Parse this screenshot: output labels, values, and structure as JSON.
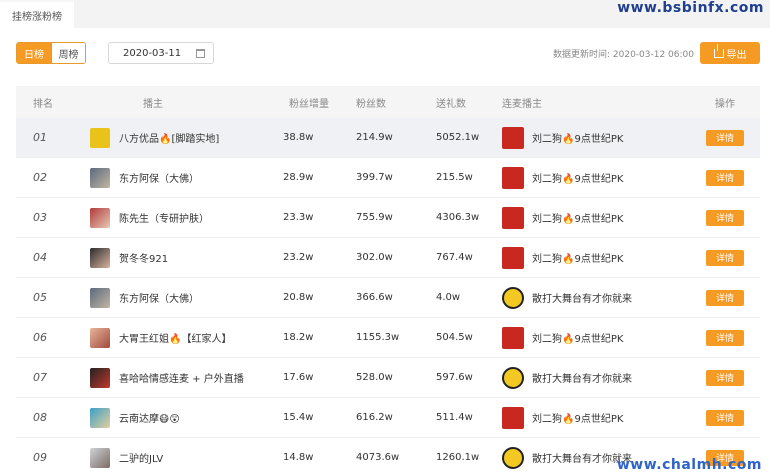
{
  "header": {
    "tab_label": "挂榜涨粉榜",
    "watermark_top": "www.bsbinfx.com",
    "watermark_bottom": "www.chalmh.com"
  },
  "filters": {
    "daily_label": "日榜",
    "weekly_label": "周榜",
    "date_value": "2020-03-11",
    "update_label": "数据更新时间: 2020-03-12 06:00",
    "export_label": "导出"
  },
  "table": {
    "columns": [
      "排名",
      "播主",
      "粉丝增量",
      "粉丝数",
      "送礼数",
      "连麦播主",
      "操作"
    ],
    "detail_label": "详情",
    "rows": [
      {
        "rank": "01",
        "anchor": "八方优品🔥[脚踏实地]",
        "fans_inc": "38.8w",
        "fans": "214.9w",
        "gifts": "5052.1w",
        "link_anchor": "刘二狗🔥9点世纪PK",
        "link_type": "red"
      },
      {
        "rank": "02",
        "anchor": "东方阿保（大佛）",
        "fans_inc": "28.9w",
        "fans": "399.7w",
        "gifts": "215.5w",
        "link_anchor": "刘二狗🔥9点世纪PK",
        "link_type": "red"
      },
      {
        "rank": "03",
        "anchor": "陈先生（专研护肤）",
        "fans_inc": "23.3w",
        "fans": "755.9w",
        "gifts": "4306.3w",
        "link_anchor": "刘二狗🔥9点世纪PK",
        "link_type": "red"
      },
      {
        "rank": "04",
        "anchor": "贺冬冬921",
        "fans_inc": "23.2w",
        "fans": "302.0w",
        "gifts": "767.4w",
        "link_anchor": "刘二狗🔥9点世纪PK",
        "link_type": "red"
      },
      {
        "rank": "05",
        "anchor": "东方阿保（大佛）",
        "fans_inc": "20.8w",
        "fans": "366.6w",
        "gifts": "4.0w",
        "link_anchor": "散打大舞台有才你就来",
        "link_type": "yellow"
      },
      {
        "rank": "06",
        "anchor": "大胃王红姐🔥【红家人】",
        "fans_inc": "18.2w",
        "fans": "1155.3w",
        "gifts": "504.5w",
        "link_anchor": "刘二狗🔥9点世纪PK",
        "link_type": "red"
      },
      {
        "rank": "07",
        "anchor": "喜哈哈情感连麦 + 户外直播",
        "fans_inc": "17.6w",
        "fans": "528.0w",
        "gifts": "597.6w",
        "link_anchor": "散打大舞台有才你就来",
        "link_type": "yellow"
      },
      {
        "rank": "08",
        "anchor": "云南达摩😷😲",
        "fans_inc": "15.4w",
        "fans": "616.2w",
        "gifts": "511.4w",
        "link_anchor": "刘二狗🔥9点世纪PK",
        "link_type": "red"
      },
      {
        "rank": "09",
        "anchor": "二驴的JLV",
        "fans_inc": "14.8w",
        "fans": "4073.6w",
        "gifts": "1260.1w",
        "link_anchor": "散打大舞台有才你就来",
        "link_type": "yellow"
      }
    ]
  }
}
